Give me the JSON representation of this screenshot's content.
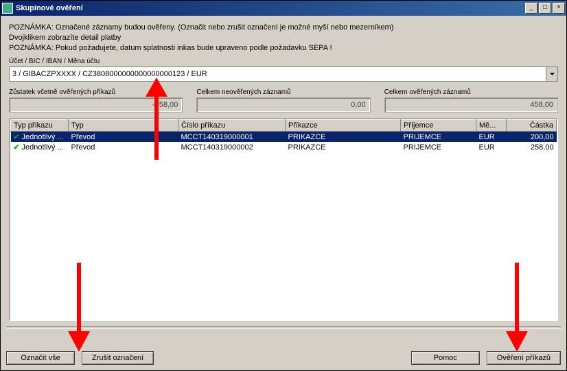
{
  "window": {
    "title": "Skupinové ověření"
  },
  "notes": {
    "line1": "POZNÁMKA: Označené záznamy budou ověřeny. (Označit nebo zrušit označení je možné myší nebo mezerníkem)",
    "line2": "Dvojklikem zobrazíte detail platby",
    "line3": "POZNÁMKA: Pokud požadujete, datum splatnosti inkas bude upraveno podle požadavku SEPA !"
  },
  "account": {
    "label": "Účet / BIC / IBAN / Měna účtu",
    "value": "3 / GIBACZPXXXX / CZ3808000000000000000123 / EUR"
  },
  "summary": {
    "balance_label": "Zůstatek včetně ověřených příkazů",
    "balance_value": "-458,00",
    "unverified_label": "Celkem neověřených záznamů",
    "unverified_value": "0,00",
    "verified_label": "Celkem ověřených záznamů",
    "verified_value": "458,00"
  },
  "grid": {
    "columns": {
      "c0": "Typ příkazu",
      "c1": "Typ",
      "c2": "Číslo příkazu",
      "c3": "Příkazce",
      "c4": "Příjemce",
      "c5": "Mě...",
      "c6": "Částka"
    },
    "rows": [
      {
        "chk": true,
        "c0": "Jednotlivý ...",
        "c1": "Převod",
        "c2": "MCCT140319000001",
        "c3": "PRIKAZCE",
        "c4": "PRIJEMCE",
        "c5": "EUR",
        "c6": "200,00",
        "selected": true
      },
      {
        "chk": true,
        "c0": "Jednotlivý ...",
        "c1": "Převod",
        "c2": "MCCT140319000002",
        "c3": "PRIKAZCE",
        "c4": "PRIJEMCE",
        "c5": "EUR",
        "c6": "258,00",
        "selected": false
      }
    ]
  },
  "buttons": {
    "mark_all": "Označit vše",
    "unmark": "Zrušit označení",
    "help": "Pomoc",
    "verify": "Ověření příkazů"
  }
}
